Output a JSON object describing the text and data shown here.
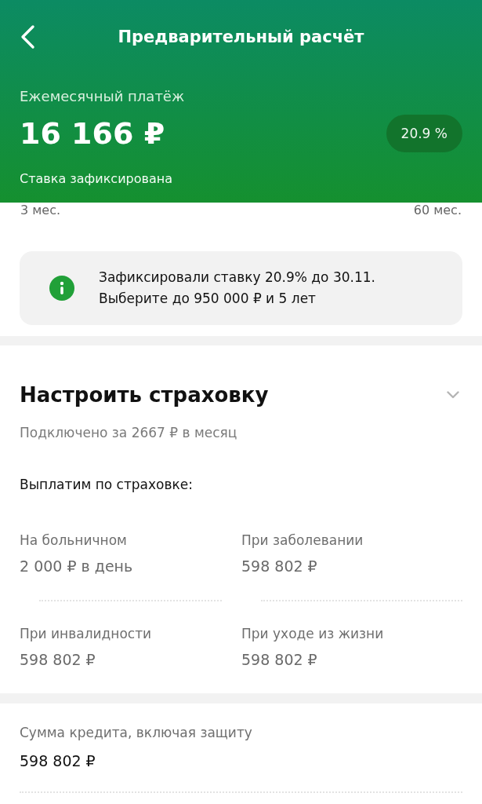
{
  "header": {
    "title": "Предварительный расчёт",
    "payment_label": "Ежемесячный платёж",
    "payment_value": "16 166 ₽",
    "rate_badge": "20.9 %",
    "rate_note": "Ставка зафиксирована"
  },
  "term_range": {
    "min": "3 мес.",
    "max": "60 мес."
  },
  "info_card": {
    "lines": [
      "Зафиксировали ставку 20.9% до 30.11.",
      "Выберите до 950 000 ₽ и 5 лет"
    ]
  },
  "insurance": {
    "title": "Настроить страховку",
    "subtitle": "Подключено за 2667 ₽ в месяц",
    "payouts_heading": "Выплатим по страховке:",
    "payouts": [
      {
        "label": "На больничном",
        "value": "2 000 ₽ в день"
      },
      {
        "label": "При заболевании",
        "value": "598 802 ₽"
      },
      {
        "label": "При инвалидности",
        "value": "598 802 ₽"
      },
      {
        "label": "При уходе из жизни",
        "value": "598 802 ₽"
      }
    ]
  },
  "loan_total": {
    "label": "Сумма кредита, включая защиту",
    "value": "598 802 ₽"
  }
}
